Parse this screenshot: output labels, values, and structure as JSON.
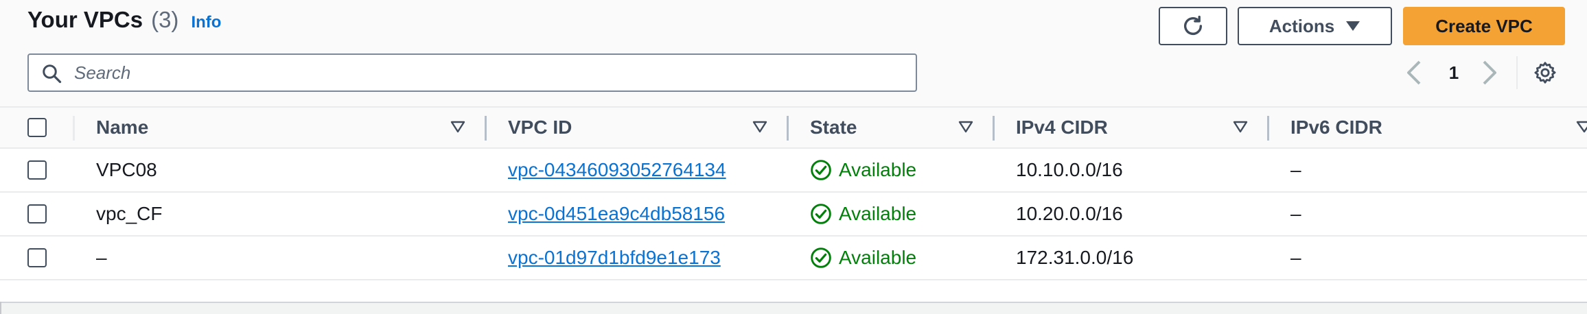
{
  "header": {
    "title": "Your VPCs",
    "count": "(3)",
    "info_label": "Info"
  },
  "toolbar": {
    "refresh_icon": "refresh-icon",
    "actions_label": "Actions",
    "create_label": "Create VPC",
    "create_color": "#f5a234"
  },
  "search": {
    "placeholder": "Search",
    "value": ""
  },
  "pagination": {
    "current_page": "1"
  },
  "table": {
    "columns": [
      "Name",
      "VPC ID",
      "State",
      "IPv4 CIDR",
      "IPv6 CIDR"
    ],
    "rows": [
      {
        "name": "VPC08",
        "vpc_id": "vpc-04346093052764134",
        "state": "Available",
        "ipv4": "10.10.0.0/16",
        "ipv6": "–"
      },
      {
        "name": "vpc_CF",
        "vpc_id": "vpc-0d451ea9c4db58156",
        "state": "Available",
        "ipv4": "10.20.0.0/16",
        "ipv6": "–"
      },
      {
        "name": "–",
        "vpc_id": "vpc-01d97d1bfd9e1e173",
        "state": "Available",
        "ipv4": "172.31.0.0/16",
        "ipv6": "–"
      }
    ]
  },
  "colors": {
    "link": "#0972d3",
    "available": "#037f0c"
  }
}
